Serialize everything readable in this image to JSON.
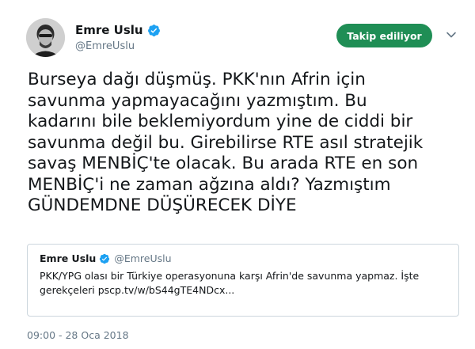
{
  "author": {
    "display_name": "Emre Uslu",
    "handle": "@EmreUslu"
  },
  "follow_button": {
    "label": "Takip ediliyor"
  },
  "tweet": {
    "text": "Burseya dağı düşmüş. PKK'nın Afrin için\nsavunma yapmayacağını yazmıştım. Bu\nkadarını bile beklemiyordum yine de ciddi bir\nsavunma değil bu. Girebilirse RTE asıl stratejik\nsavaş MENBİÇ'te olacak. Bu arada RTE en son\nMENBİÇ'i ne zaman ağzına aldı? Yazmıştım\nGÜNDEMDNE DÜŞÜRECEK DİYE",
    "timestamp": "09:00 - 28 Oca 2018"
  },
  "quoted_tweet": {
    "display_name": "Emre Uslu",
    "handle": "@EmreUslu",
    "text": "PKK/YPG olası bir Türkiye operasyonuna karşı Afrin'de savunma yapmaz. İşte\ngerekçeleri pscp.tv/w/bS44gTE4NDcx..."
  },
  "icons": {
    "verified": "verified-badge-icon",
    "caret": "chevron-down-icon"
  },
  "colors": {
    "follow_button": "#1f8e55",
    "verified": "#1da1f2",
    "muted_text": "#657786",
    "border": "#ccd6dd"
  }
}
